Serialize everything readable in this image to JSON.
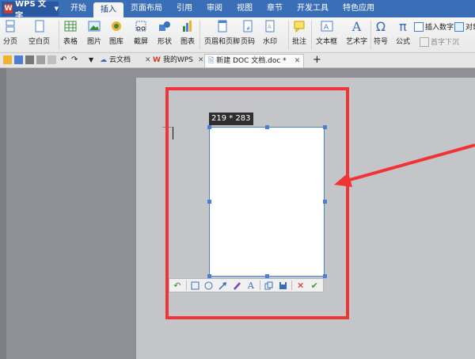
{
  "menubar": {
    "app_name": "WPS 文字",
    "tabs": [
      "开始",
      "插入",
      "页面布局",
      "引用",
      "审阅",
      "视图",
      "章节",
      "开发工具",
      "特色应用"
    ],
    "active_tab": "插入"
  },
  "ribbon": {
    "buttons": [
      "分页",
      "空白页",
      "表格",
      "图片",
      "图库",
      "截屏",
      "形状",
      "图表",
      "页眉和页脚",
      "页码",
      "水印",
      "批注",
      "文本框",
      "艺术字",
      "符号",
      "公式"
    ],
    "small_buttons": [
      "插入数字",
      "对象",
      "首字下沉"
    ]
  },
  "doc_tabs": [
    {
      "label": "云文档"
    },
    {
      "label": "我的WPS"
    },
    {
      "label": "新建 DOC 文档.doc *"
    }
  ],
  "screenshot_tool": {
    "dimension_label": "219 * 283"
  },
  "colors": {
    "menubar": "#3a6fb7",
    "highlight": "#f03434",
    "selection": "#4a7fd4"
  }
}
